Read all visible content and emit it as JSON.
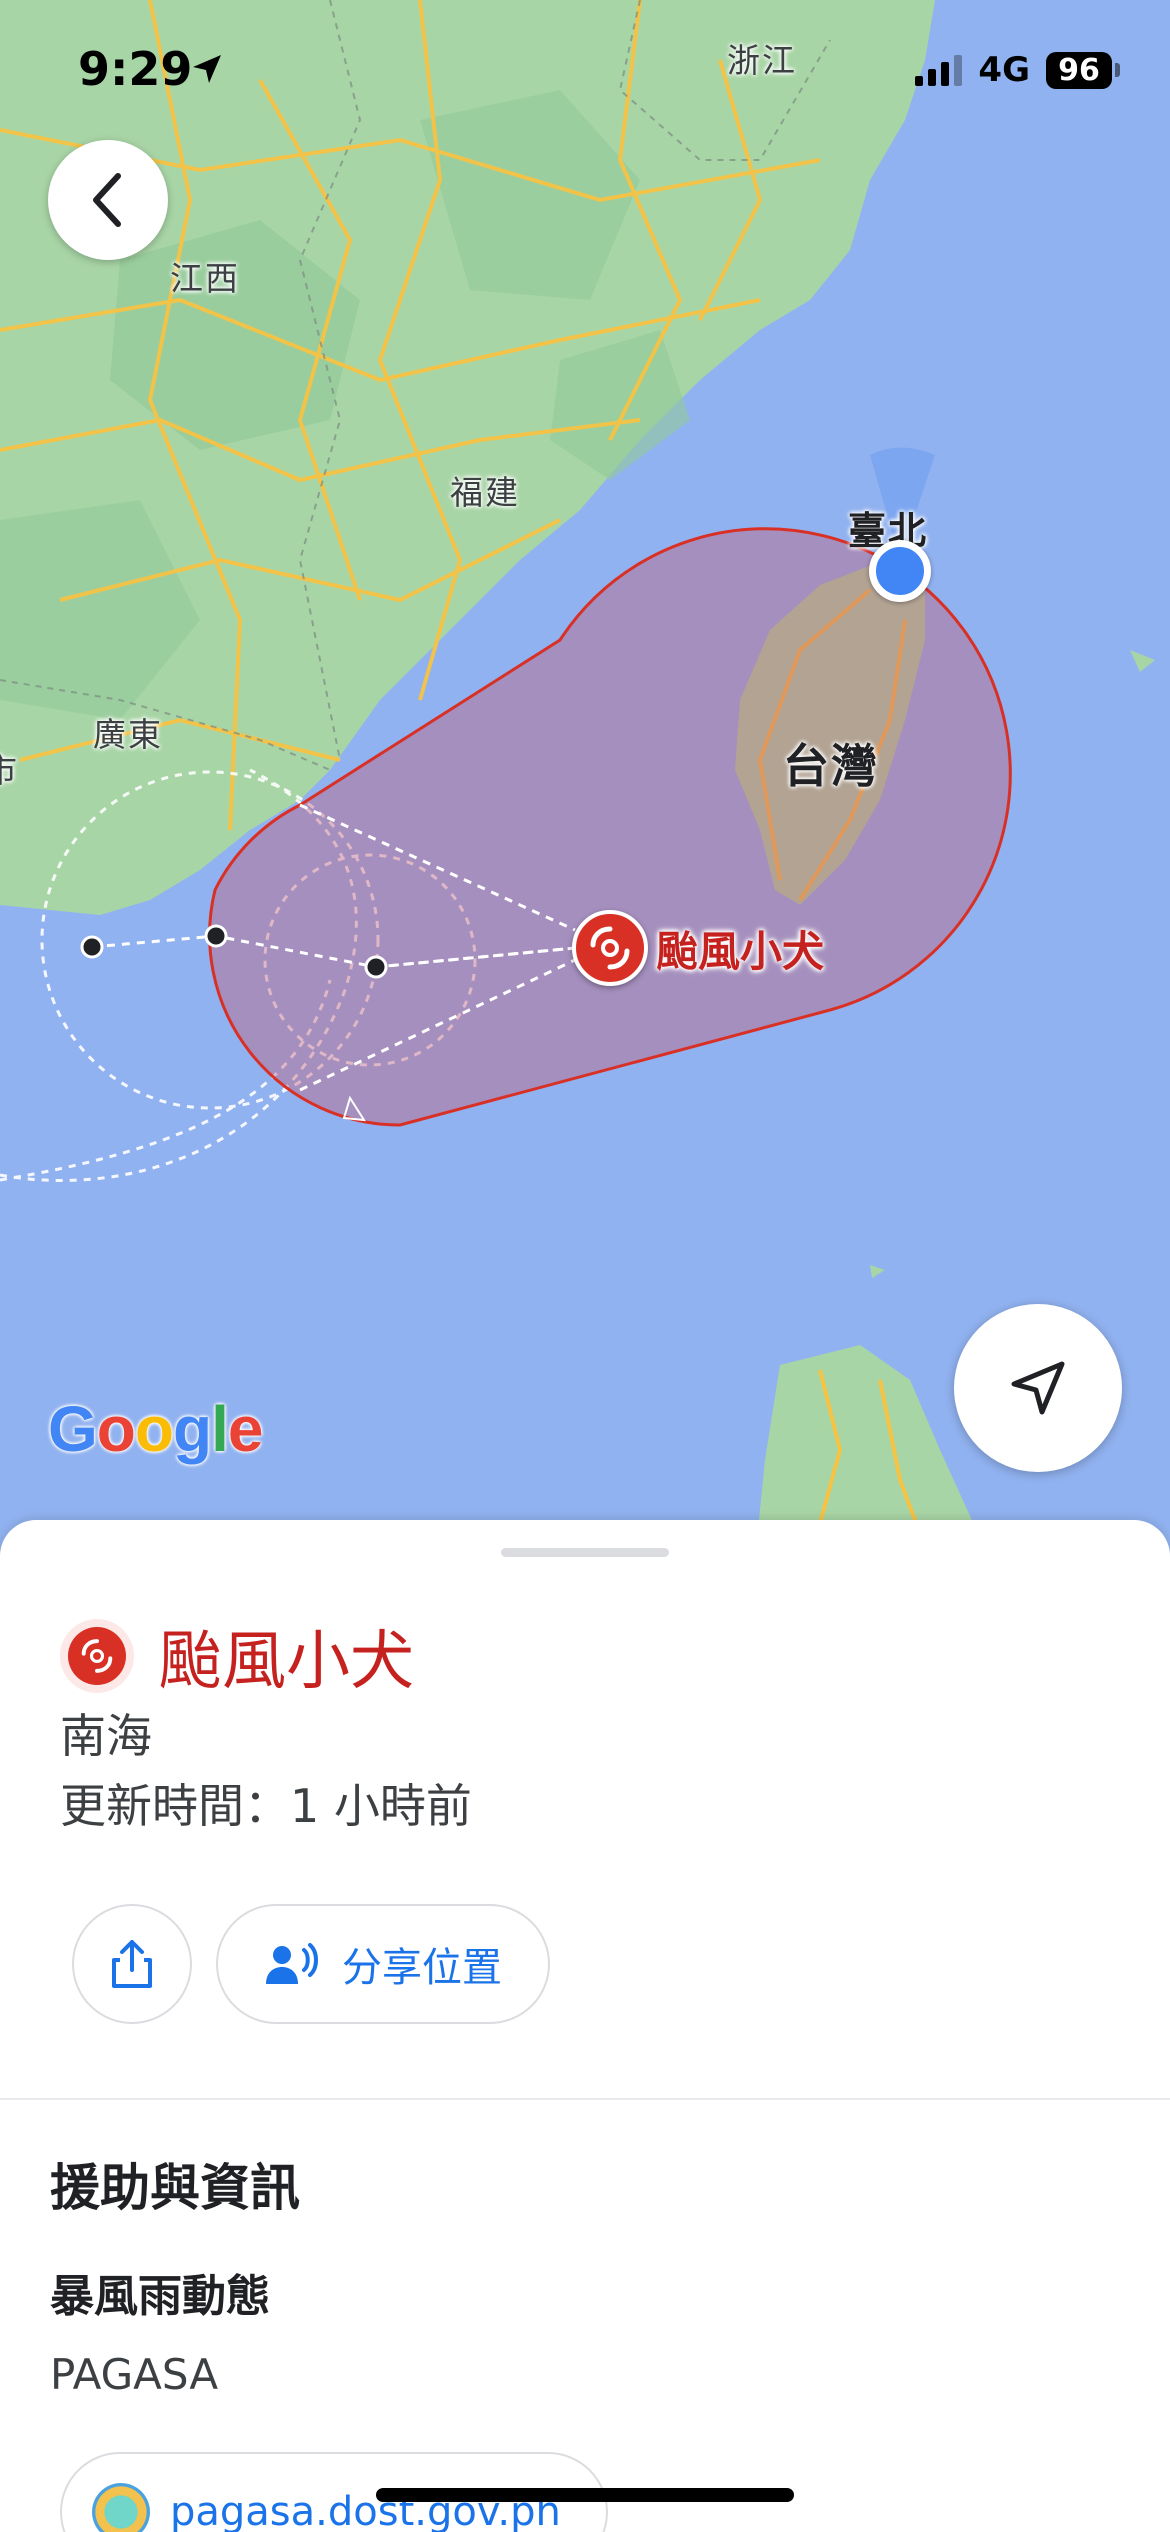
{
  "status_bar": {
    "time": "9:29",
    "network": "4G",
    "battery": "96"
  },
  "map": {
    "labels": {
      "zhejiang": "浙江",
      "jiangxi": "江西",
      "fujian": "福建",
      "guangdong": "廣東",
      "taipei": "臺北",
      "taiwan": "台灣",
      "left_edge": "市"
    },
    "storm_label": "颱風小犬",
    "google_logo": {
      "letters": [
        "G",
        "o",
        "o",
        "g",
        "l",
        "e"
      ],
      "colors": [
        "#4285F4",
        "#EA4335",
        "#FBBC05",
        "#4285F4",
        "#34A853",
        "#EA4335"
      ]
    },
    "colors": {
      "water": "#91b2f0",
      "land": "#a8d5a6",
      "forecast_cone_fill": "#c2607a",
      "forecast_cone_stroke": "#d93025",
      "my_location": "#4285f4"
    }
  },
  "place": {
    "title": "颱風小犬",
    "subtitle": "南海",
    "updated": "更新時間：1 小時前"
  },
  "actions": {
    "share_location_label": "分享位置"
  },
  "info": {
    "section_title": "援助與資訊",
    "sub_title": "暴風雨動態",
    "agency": "PAGASA",
    "link_text": "pagasa.dost.gov.ph"
  }
}
